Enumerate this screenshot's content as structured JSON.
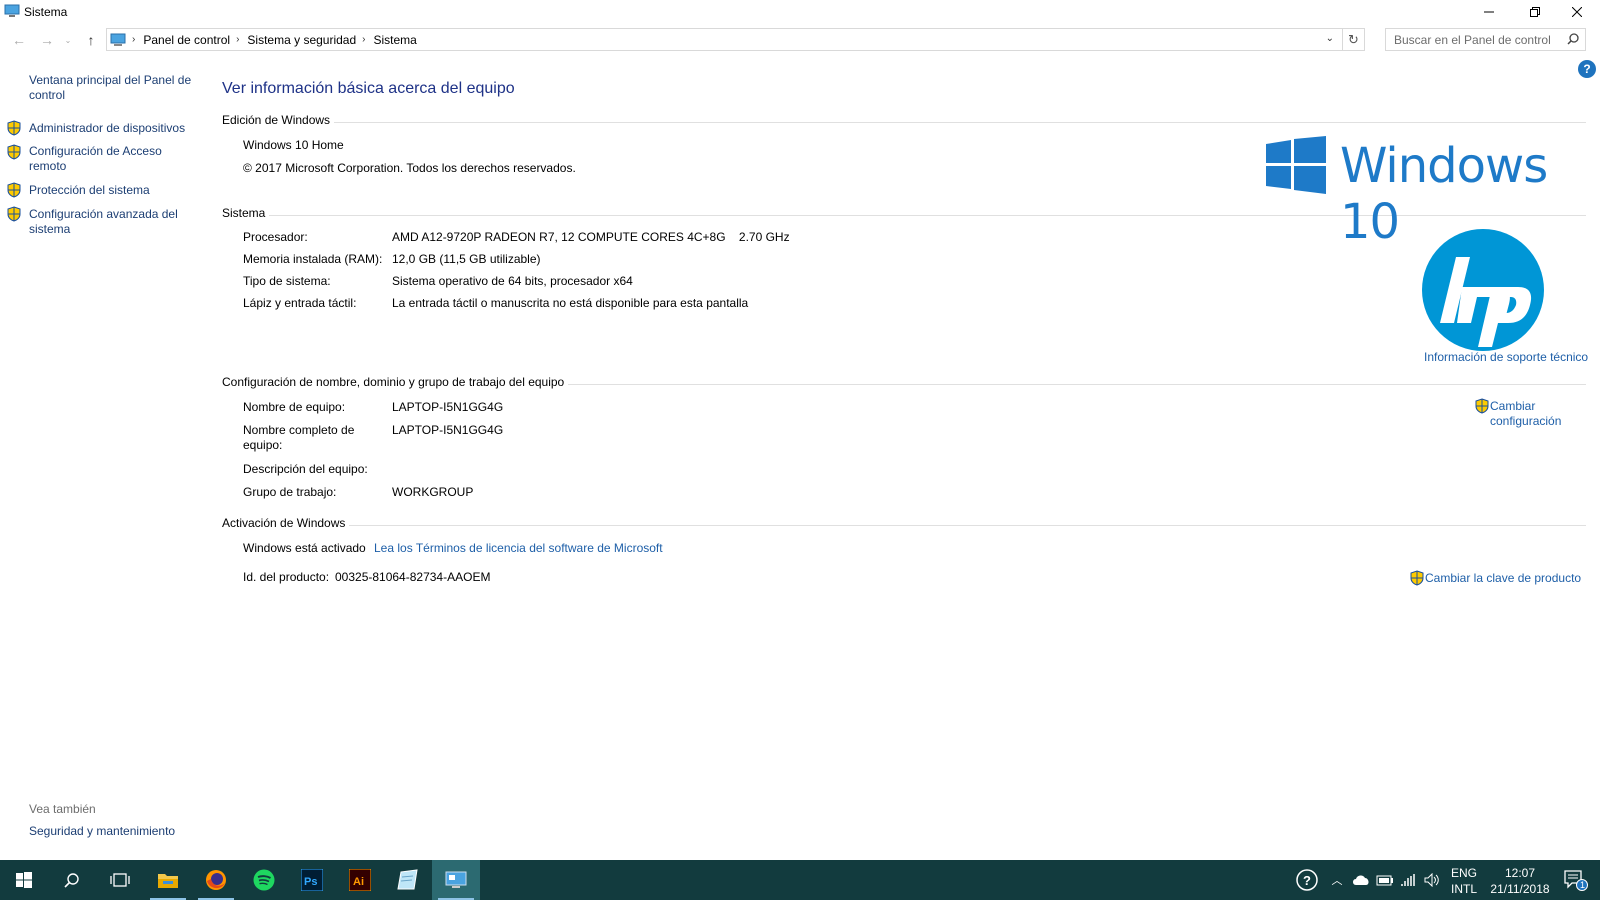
{
  "window": {
    "title": "Sistema",
    "minimize_icon": "minimize-icon",
    "maximize_icon": "restore-icon",
    "close_icon": "close-icon"
  },
  "navigation": {
    "breadcrumbs": [
      "Panel de control",
      "Sistema y seguridad",
      "Sistema"
    ],
    "search_placeholder": "Buscar en el Panel de control"
  },
  "sidebar": {
    "home_link": "Ventana principal del Panel de control",
    "items": [
      {
        "label": "Administrador de dispositivos",
        "icon": "uac-shield-icon"
      },
      {
        "label": "Configuración de Acceso remoto",
        "icon": "uac-shield-icon"
      },
      {
        "label": "Protección del sistema",
        "icon": "uac-shield-icon"
      },
      {
        "label": "Configuración avanzada del sistema",
        "icon": "uac-shield-icon"
      }
    ],
    "see_also_heading": "Vea también",
    "see_also_link": "Seguridad y mantenimiento"
  },
  "main": {
    "title": "Ver información básica acerca del equipo",
    "edition": {
      "heading": "Edición de Windows",
      "name": "Windows 10 Home",
      "copyright": "© 2017 Microsoft Corporation. Todos los derechos reservados.",
      "logo_text": "Windows 10"
    },
    "system": {
      "heading": "Sistema",
      "rows": [
        {
          "label": "Procesador:",
          "value": "AMD A12-9720P RADEON R7, 12 COMPUTE CORES 4C+8G    2.70 GHz"
        },
        {
          "label": "Memoria instalada (RAM):",
          "value": "12,0 GB (11,5 GB utilizable)"
        },
        {
          "label": "Tipo de sistema:",
          "value": "Sistema operativo de 64 bits, procesador x64"
        },
        {
          "label": "Lápiz y entrada táctil:",
          "value": "La entrada táctil o manuscrita no está disponible para esta pantalla"
        }
      ],
      "support_link": "Información de soporte técnico"
    },
    "computer_name": {
      "heading": "Configuración de nombre, dominio y grupo de trabajo del equipo",
      "rows": [
        {
          "label": "Nombre de equipo:",
          "value": "LAPTOP-I5N1GG4G"
        },
        {
          "label": "Nombre completo de equipo:",
          "value": "LAPTOP-I5N1GG4G"
        },
        {
          "label": "Descripción del equipo:",
          "value": ""
        },
        {
          "label": "Grupo de trabajo:",
          "value": "WORKGROUP"
        }
      ],
      "change_link": "Cambiar configuración"
    },
    "activation": {
      "heading": "Activación de Windows",
      "status": "Windows está activado",
      "license_link": "Lea los Términos de licencia del software de Microsoft",
      "product_id_label": "Id. del producto:",
      "product_id": "00325-81064-82734-AAOEM",
      "change_key_link": "Cambiar la clave de producto"
    }
  },
  "taskbar": {
    "apps": [
      "start-icon",
      "search-icon",
      "task-view-icon",
      "file-explorer-icon",
      "firefox-icon",
      "spotify-icon",
      "photoshop-icon",
      "illustrator-icon",
      "notes-icon",
      "control-panel-icon"
    ],
    "lang_line1": "ENG",
    "lang_line2": "INTL",
    "time": "12:07",
    "date": "21/11/2018",
    "notification_count": "1"
  }
}
